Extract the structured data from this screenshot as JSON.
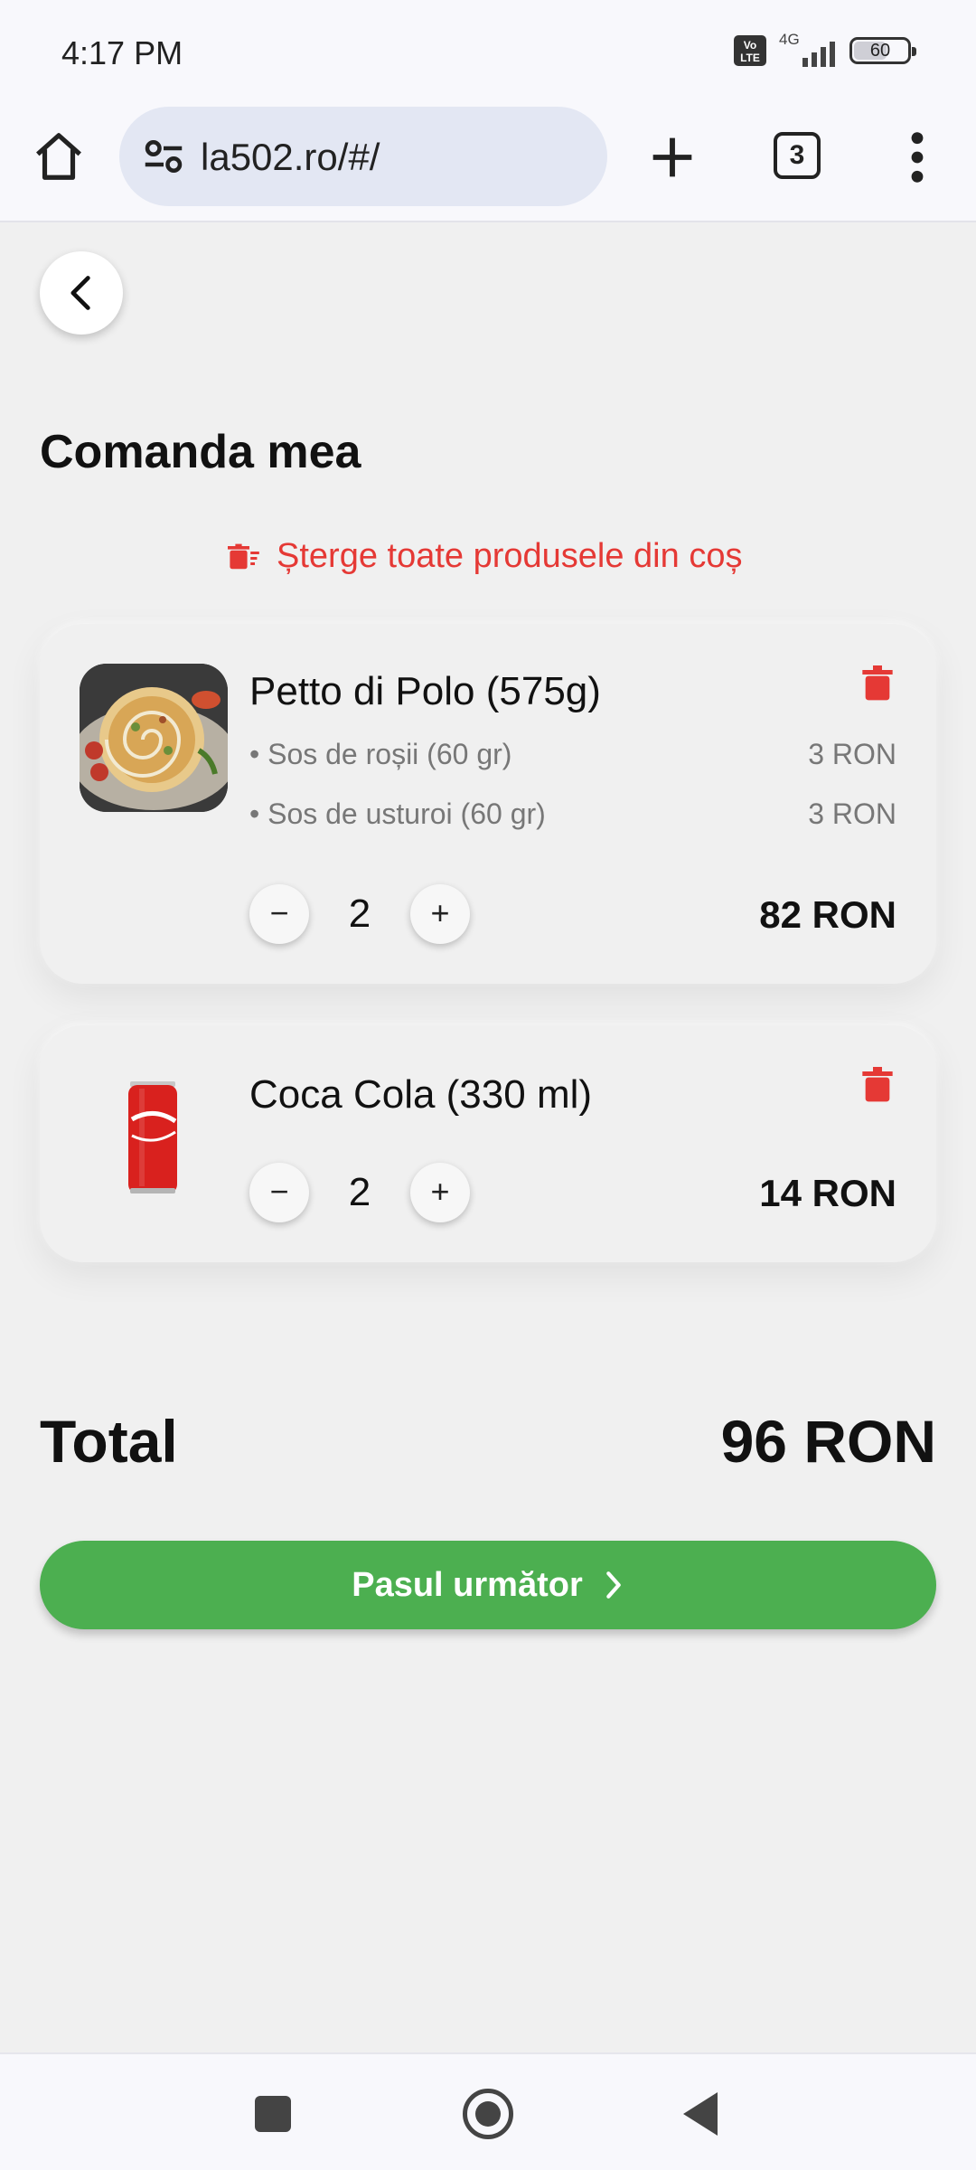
{
  "status_bar": {
    "time": "4:17 PM",
    "volte": "Vo LTE",
    "network": "4G",
    "battery": "60"
  },
  "browser": {
    "url": "la502.ro/#/",
    "tab_count": "3"
  },
  "page": {
    "title": "Comanda mea",
    "clear_cart_label": "Șterge toate produsele din coș"
  },
  "cart": [
    {
      "name": "Petto di Polo (575g)",
      "extras": [
        {
          "label": "• Sos de roșii (60 gr)",
          "price": "3 RON"
        },
        {
          "label": "• Sos de usturoi (60 gr)",
          "price": "3 RON"
        }
      ],
      "quantity": "2",
      "price": "82 RON"
    },
    {
      "name": "Coca Cola (330 ml)",
      "quantity": "2",
      "price": "14 RON"
    }
  ],
  "summary": {
    "total_label": "Total",
    "total_value": "96 RON"
  },
  "actions": {
    "next_label": "Pasul următor",
    "minus": "−",
    "plus": "+"
  },
  "colors": {
    "accent_green": "#4caf50",
    "danger_red": "#e53935"
  },
  "icons": [
    "home-icon",
    "tune-icon",
    "plus-icon",
    "tabs-icon",
    "more-vert-icon",
    "back-arrow-icon",
    "clear-cart-icon",
    "trash-icon",
    "chevron-right-icon"
  ]
}
